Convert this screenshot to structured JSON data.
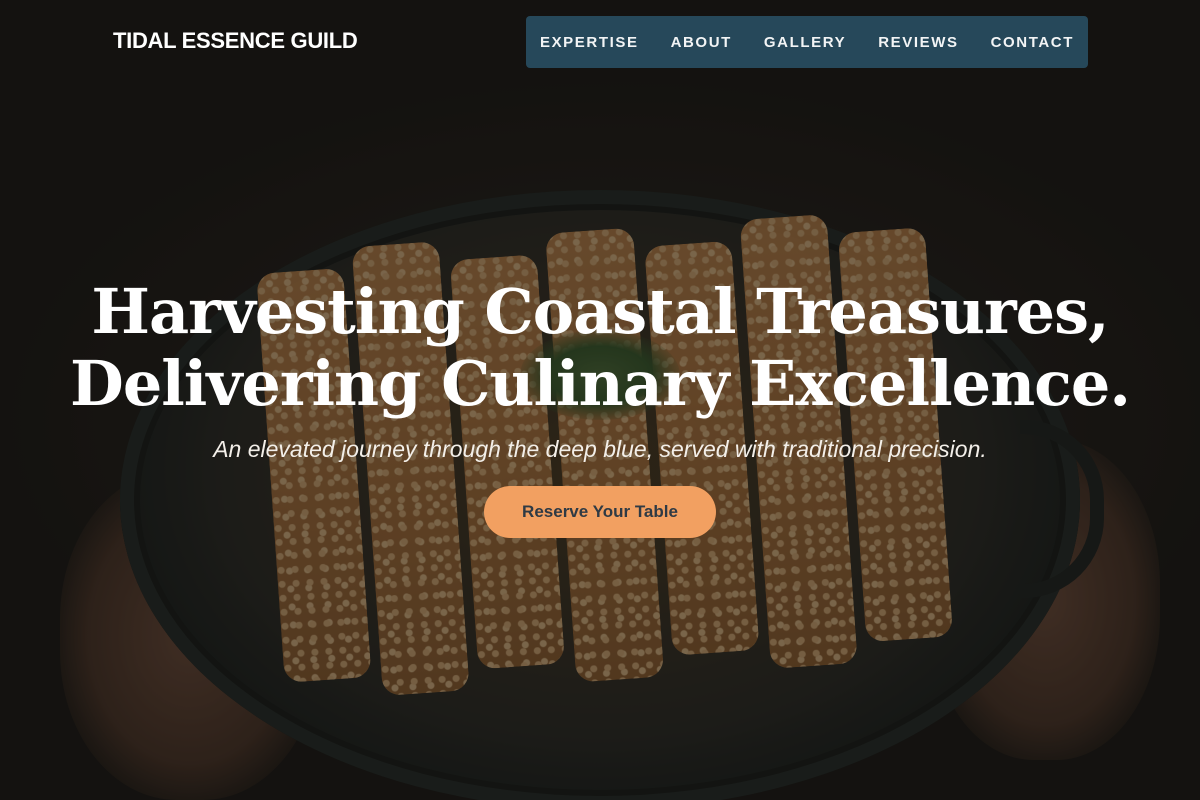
{
  "header": {
    "brand": "TIDAL ESSENCE GUILD",
    "nav": [
      "EXPERTISE",
      "ABOUT",
      "GALLERY",
      "REVIEWS",
      "CONTACT"
    ]
  },
  "hero": {
    "headline_line1": "Harvesting Coastal Treasures,",
    "headline_line2": "Delivering Culinary Excellence.",
    "subtitle": "An elevated journey through the deep blue, served with traditional precision.",
    "cta_label": "Reserve Your Table"
  },
  "colors": {
    "nav_background": "#26485a",
    "cta_background": "#f2a061",
    "cta_text": "#2f3a44"
  },
  "icons": []
}
